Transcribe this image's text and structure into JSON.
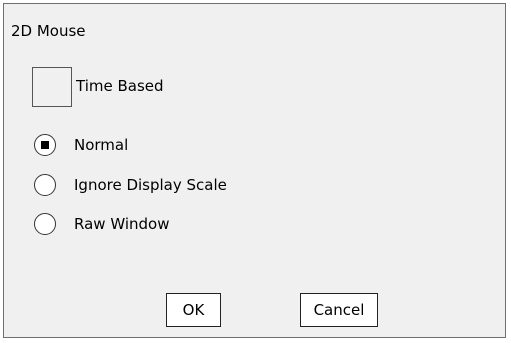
{
  "dialog": {
    "title": "2D Mouse"
  },
  "time_based": {
    "label": "Time Based",
    "checked": false
  },
  "mode_options": [
    {
      "label": "Normal",
      "selected": true
    },
    {
      "label": "Ignore Display Scale",
      "selected": false
    },
    {
      "label": "Raw Window",
      "selected": false
    }
  ],
  "buttons": {
    "ok_label": "OK",
    "cancel_label": "Cancel"
  }
}
